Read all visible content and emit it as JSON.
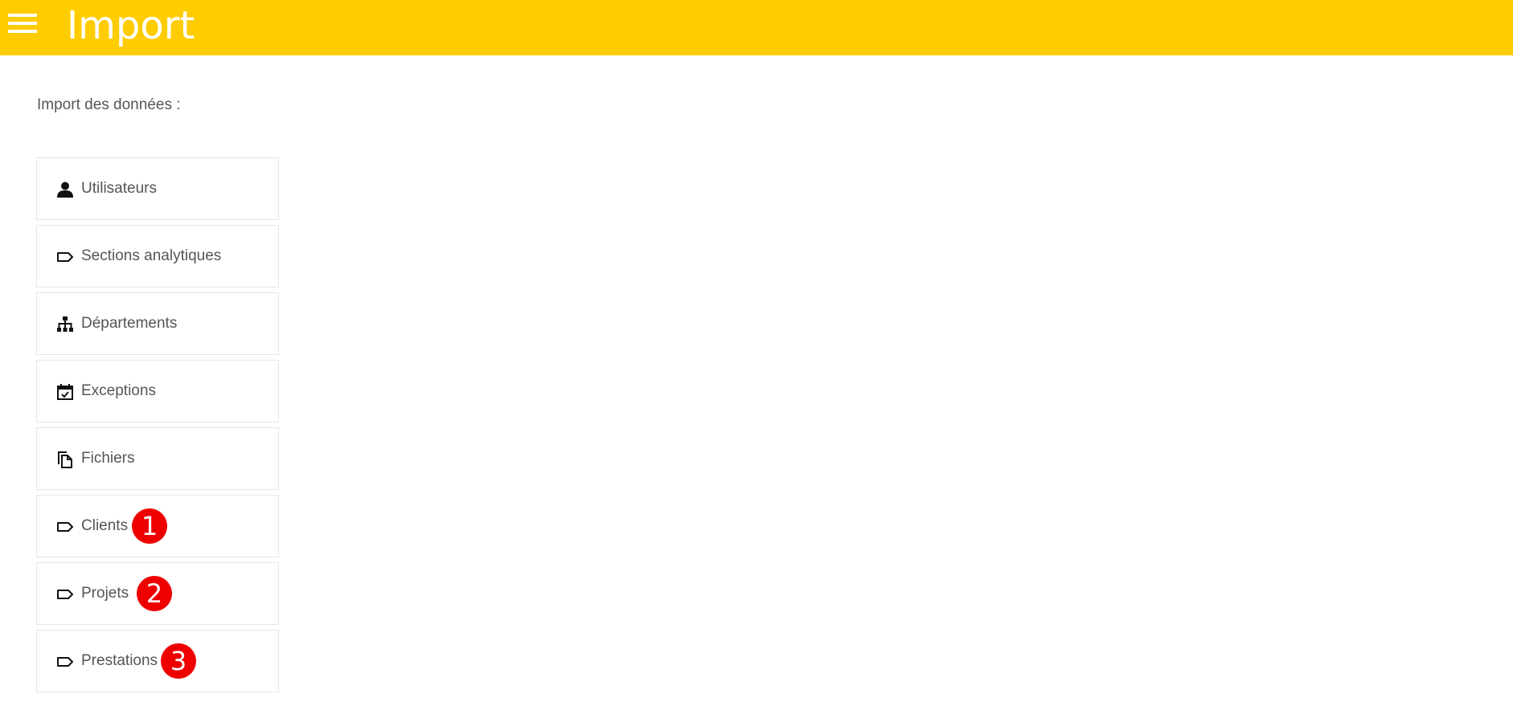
{
  "header": {
    "title": "Import",
    "background_color": "#ffcc00",
    "menu_icon": "hamburger-menu-icon"
  },
  "main": {
    "intro_text": "Import des données :",
    "items": [
      {
        "label": "Utilisateurs",
        "icon": "user-icon"
      },
      {
        "label": "Sections analytiques",
        "icon": "tag-icon"
      },
      {
        "label": "Départements",
        "icon": "hierarchy-icon"
      },
      {
        "label": "Exceptions",
        "icon": "calendar-check-icon"
      },
      {
        "label": "Fichiers",
        "icon": "files-icon"
      },
      {
        "label": "Clients",
        "icon": "tag-icon",
        "badge": "1"
      },
      {
        "label": "Projets",
        "icon": "tag-icon",
        "badge": "2"
      },
      {
        "label": "Prestations",
        "icon": "tag-icon",
        "badge": "3"
      }
    ]
  },
  "annotation_color": "#ee0000"
}
